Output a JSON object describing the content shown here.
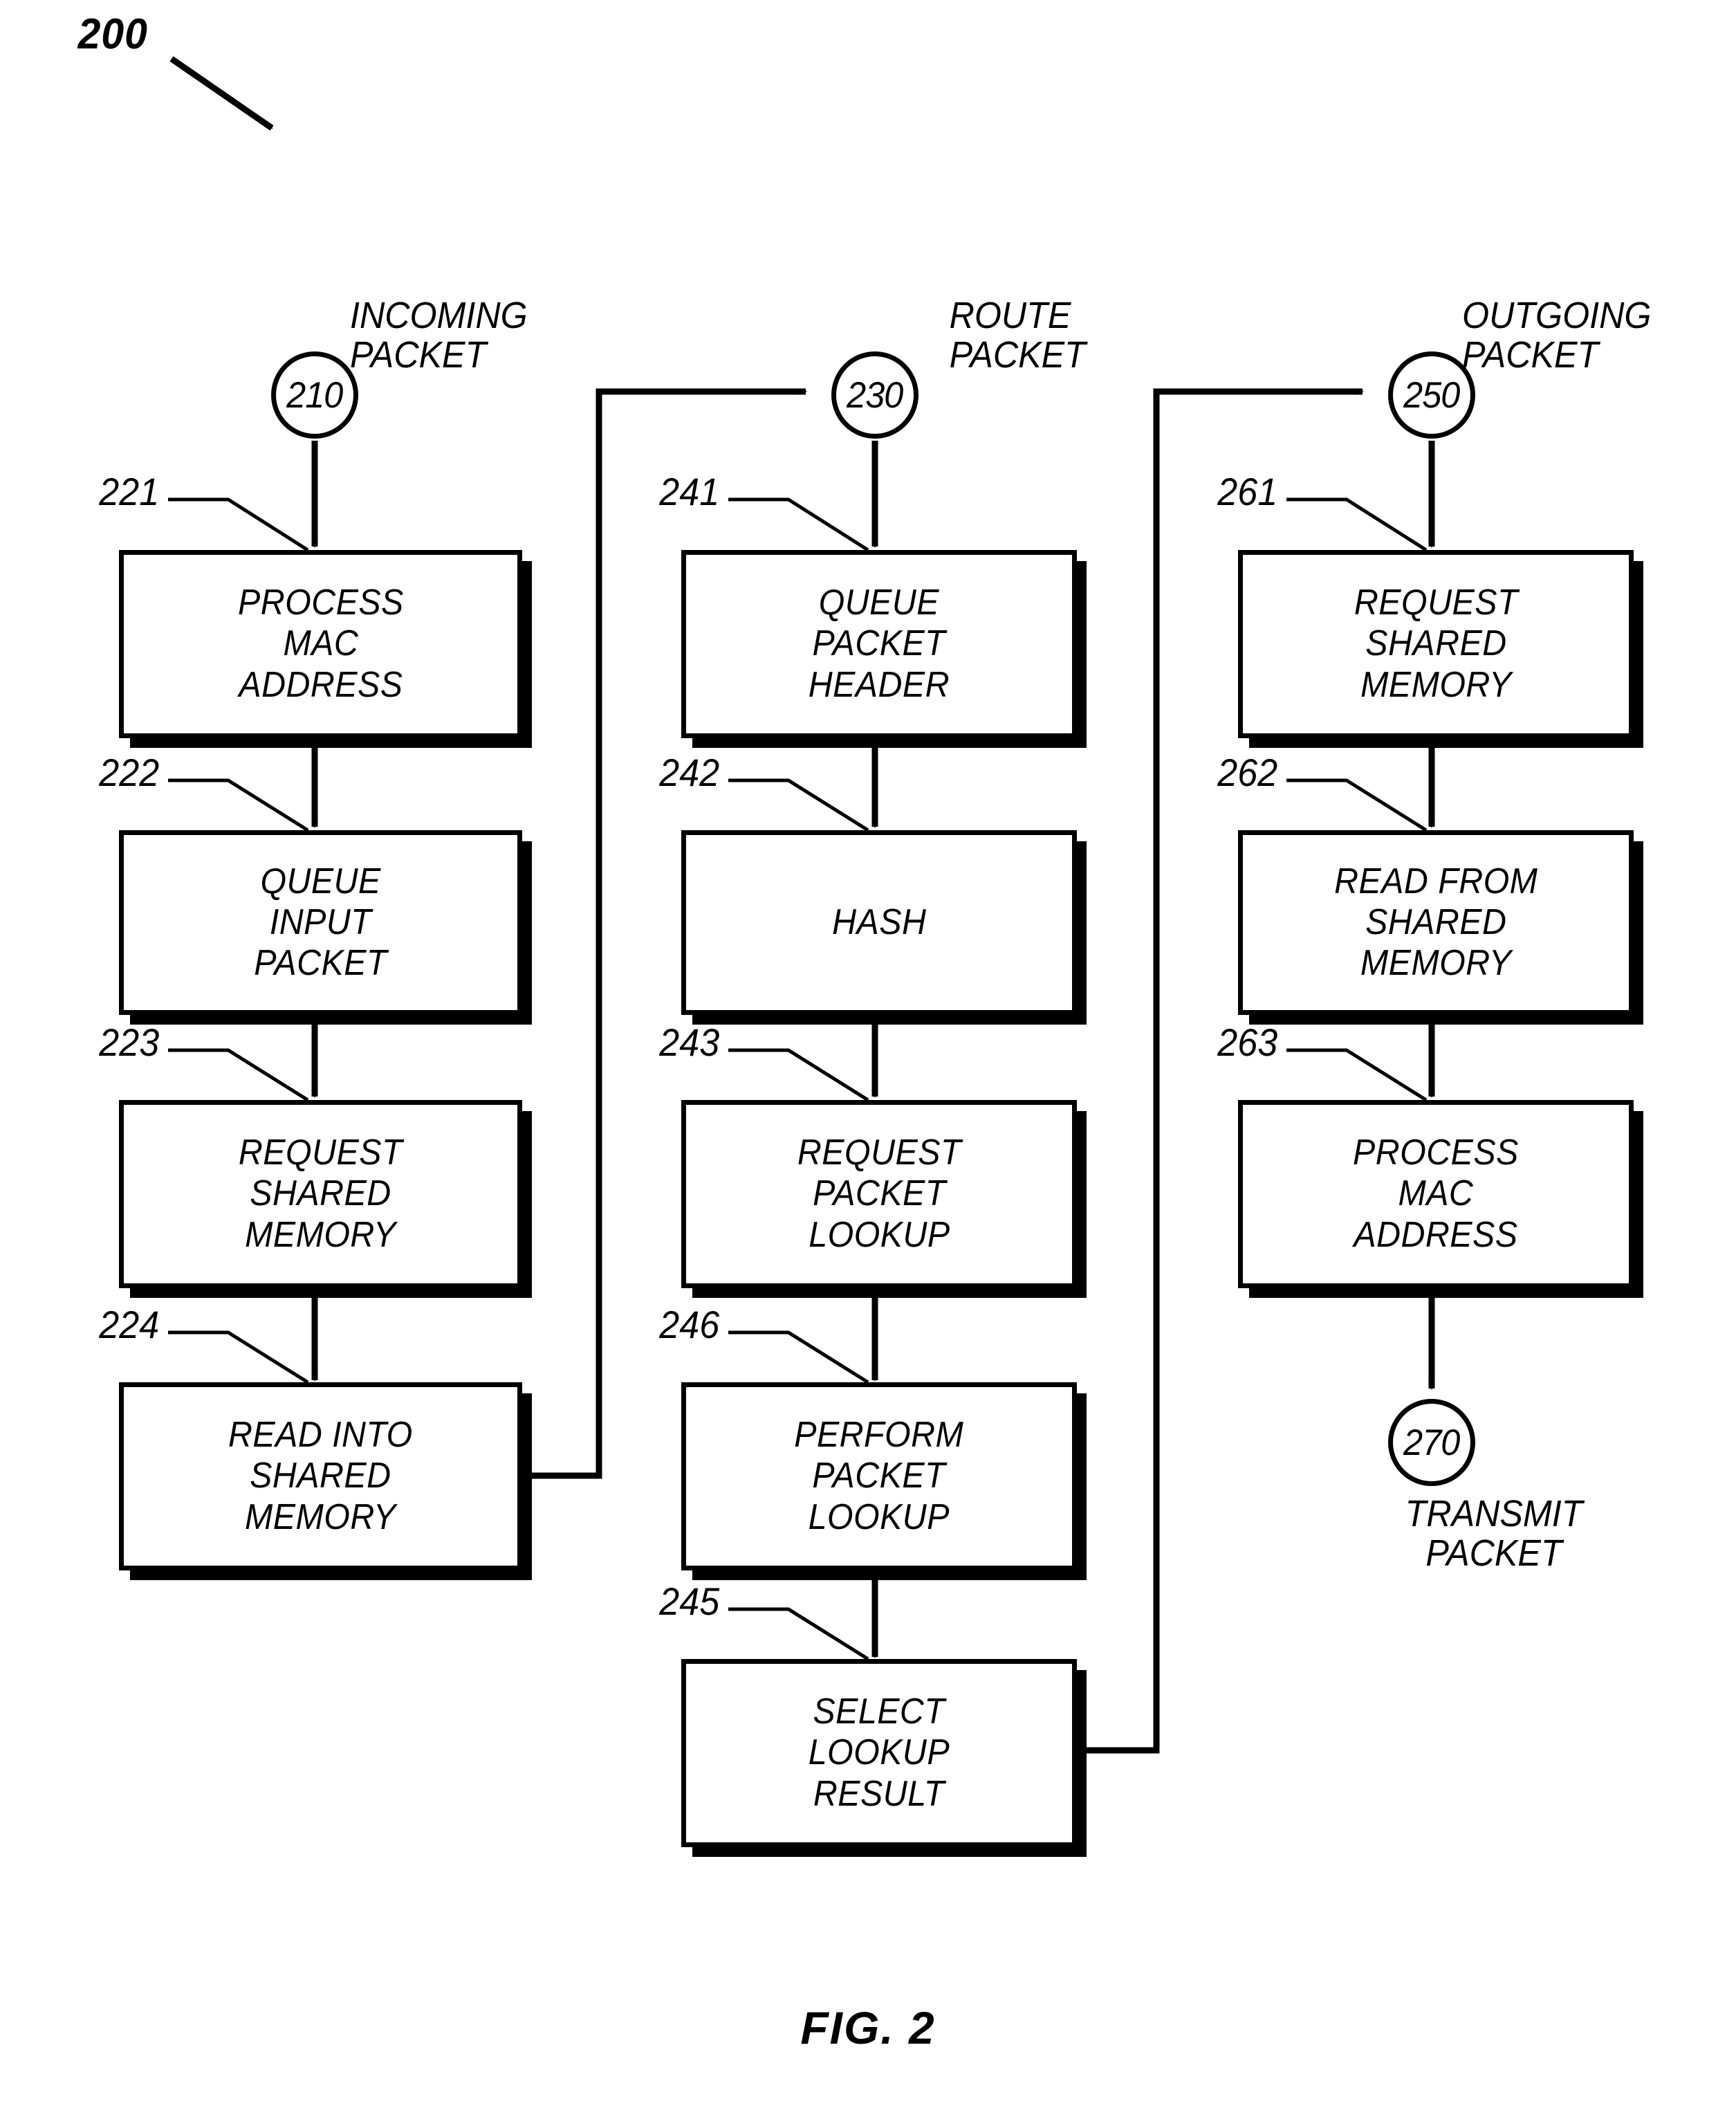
{
  "figure": {
    "head_label": "200",
    "caption": "FIG. 2"
  },
  "terminators": [
    {
      "id": "210",
      "label": "INCOMING\nPACKET"
    },
    {
      "id": "230",
      "label": "ROUTE\nPACKET"
    },
    {
      "id": "250",
      "label": "OUTGOING\nPACKET"
    },
    {
      "id": "270",
      "label": "TRANSMIT\nPACKET"
    }
  ],
  "columns": [
    {
      "name": "incoming-packet-column",
      "steps": [
        {
          "ref": "221",
          "text": "PROCESS\nMAC\nADDRESS"
        },
        {
          "ref": "222",
          "text": "QUEUE\nINPUT\nPACKET"
        },
        {
          "ref": "223",
          "text": "REQUEST\nSHARED\nMEMORY"
        },
        {
          "ref": "224",
          "text": "READ INTO\nSHARED\nMEMORY"
        }
      ]
    },
    {
      "name": "route-packet-column",
      "steps": [
        {
          "ref": "241",
          "text": "QUEUE\nPACKET\nHEADER"
        },
        {
          "ref": "242",
          "text": "HASH"
        },
        {
          "ref": "243",
          "text": "REQUEST\nPACKET\nLOOKUP"
        },
        {
          "ref": "246",
          "text": "PERFORM\nPACKET\nLOOKUP"
        },
        {
          "ref": "245",
          "text": "SELECT\nLOOKUP\nRESULT"
        }
      ]
    },
    {
      "name": "outgoing-packet-column",
      "steps": [
        {
          "ref": "261",
          "text": "REQUEST\nSHARED\nMEMORY"
        },
        {
          "ref": "262",
          "text": "READ FROM\nSHARED\nMEMORY"
        },
        {
          "ref": "263",
          "text": "PROCESS\nMAC\nADDRESS"
        }
      ]
    }
  ],
  "colors": {
    "ink": "#000000",
    "paper": "#ffffff"
  }
}
